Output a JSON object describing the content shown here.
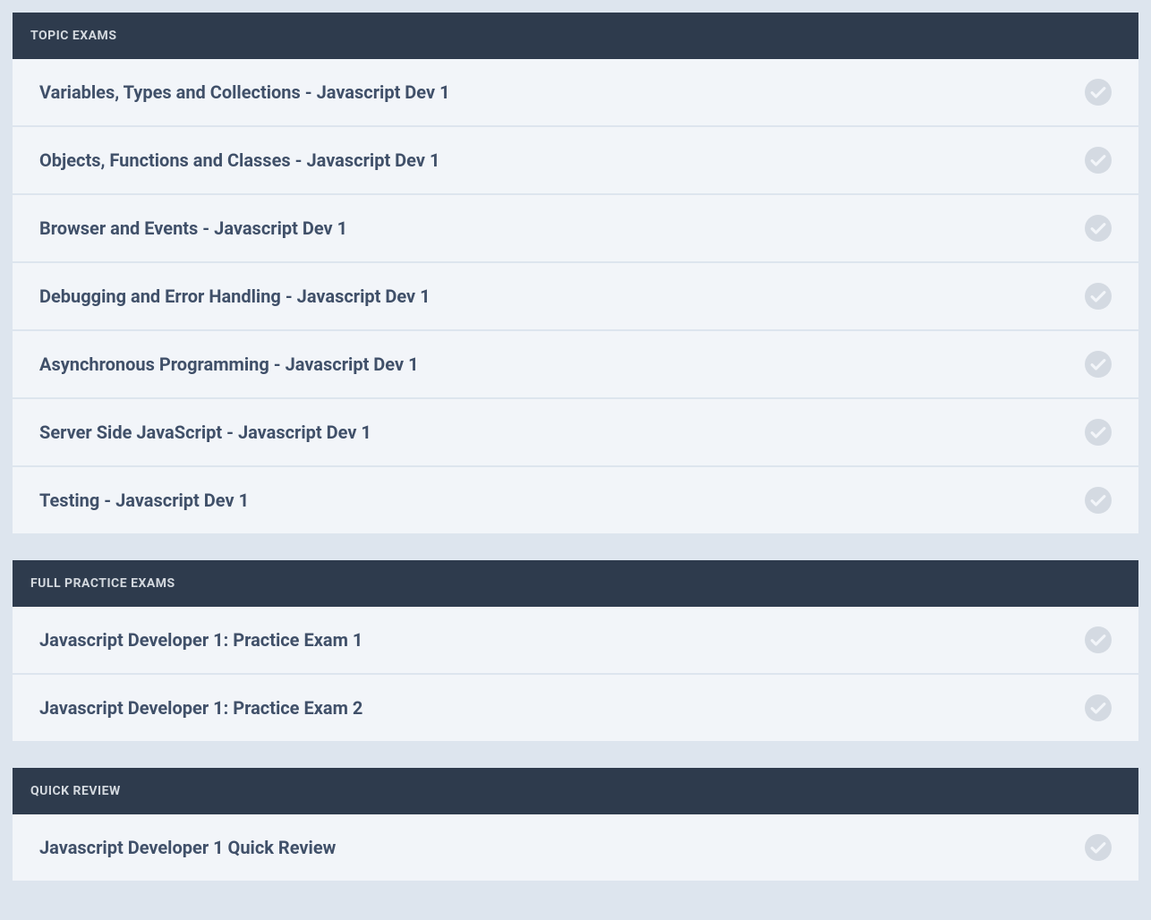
{
  "sections": [
    {
      "header": "TOPIC EXAMS",
      "items": [
        {
          "title": "Variables, Types and Collections - Javascript Dev 1"
        },
        {
          "title": "Objects, Functions and Classes - Javascript Dev 1"
        },
        {
          "title": "Browser and Events - Javascript Dev 1"
        },
        {
          "title": "Debugging and Error Handling - Javascript Dev 1"
        },
        {
          "title": "Asynchronous Programming - Javascript Dev 1"
        },
        {
          "title": "Server Side JavaScript - Javascript Dev 1"
        },
        {
          "title": "Testing - Javascript Dev 1"
        }
      ]
    },
    {
      "header": "FULL PRACTICE EXAMS",
      "items": [
        {
          "title": "Javascript Developer 1: Practice Exam 1"
        },
        {
          "title": "Javascript Developer 1: Practice Exam 2"
        }
      ]
    },
    {
      "header": "QUICK REVIEW",
      "items": [
        {
          "title": "Javascript Developer 1 Quick Review"
        }
      ]
    }
  ]
}
